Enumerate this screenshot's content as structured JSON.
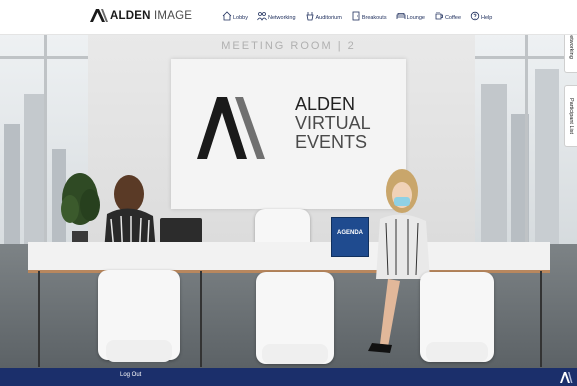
{
  "header": {
    "logo_bold": "ALDEN",
    "logo_light": "IMAGE",
    "nav": [
      {
        "label": "Lobby",
        "icon": "home-icon"
      },
      {
        "label": "Networking",
        "icon": "people-icon"
      },
      {
        "label": "Auditorium",
        "icon": "podium-icon"
      },
      {
        "label": "Breakouts",
        "icon": "door-icon"
      },
      {
        "label": "Lounge",
        "icon": "couch-icon"
      },
      {
        "label": "Coffee",
        "icon": "coffee-icon"
      },
      {
        "label": "Help",
        "icon": "help-icon"
      }
    ]
  },
  "room": {
    "label": "MEETING ROOM | 2",
    "screen_line1": "ALDEN",
    "screen_line2": "VIRTUAL",
    "screen_line3": "EVENTS",
    "agenda": "AGENDA"
  },
  "side_tabs": {
    "networking": "Networking",
    "participants": "Participant List"
  },
  "footer": {
    "logout": "Log Out"
  },
  "colors": {
    "nav_text": "#20305e",
    "footer_bg": "#1b2f6b",
    "agenda_bg": "#1f4b8f"
  }
}
